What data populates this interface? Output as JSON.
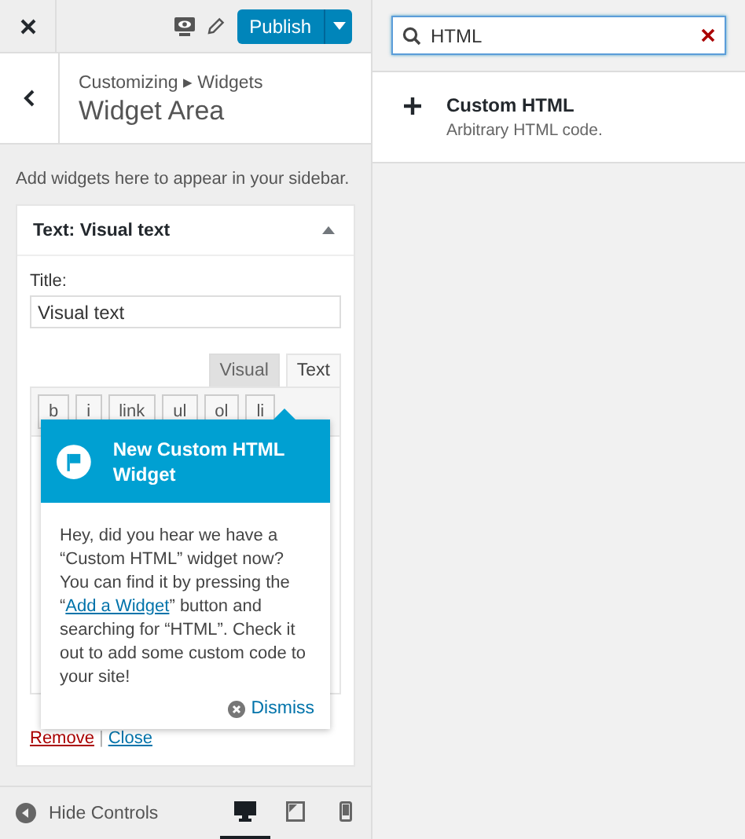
{
  "topbar": {
    "publish": "Publish"
  },
  "header": {
    "breadcrumb": "Customizing ▸ Widgets",
    "title": "Widget Area"
  },
  "description": "Add widgets here to appear in your sidebar.",
  "widget": {
    "title": "Text: Visual text",
    "expanded": true,
    "field_label": "Title:",
    "field_value": "Visual text",
    "tabs": [
      {
        "label": "Visual",
        "selected": false
      },
      {
        "label": "Text",
        "selected": true
      }
    ],
    "quicktags": [
      "b",
      "i",
      "link",
      "ul",
      "ol",
      "li"
    ],
    "actions": [
      "Remove",
      "Close"
    ],
    "actions_separator": "|"
  },
  "pointer": {
    "title": "New Custom HTML Widget",
    "body_before": "Hey, did you hear we have a “Custom HTML” widget now? You can find it by pressing the “",
    "link": "Add a Widget",
    "body_after": "” button and searching for “HTML”. Check it out to add some custom code to your site!",
    "dismiss": "Dismiss"
  },
  "footer": {
    "hide_controls": "Hide Controls",
    "devices": [
      {
        "kind": "desktop",
        "selected": true
      },
      {
        "kind": "tablet",
        "selected": false
      },
      {
        "kind": "mobile",
        "selected": false
      }
    ]
  },
  "search": {
    "value": "HTML"
  },
  "results": [
    {
      "name": "Custom HTML",
      "description": "Arbitrary HTML code."
    }
  ]
}
